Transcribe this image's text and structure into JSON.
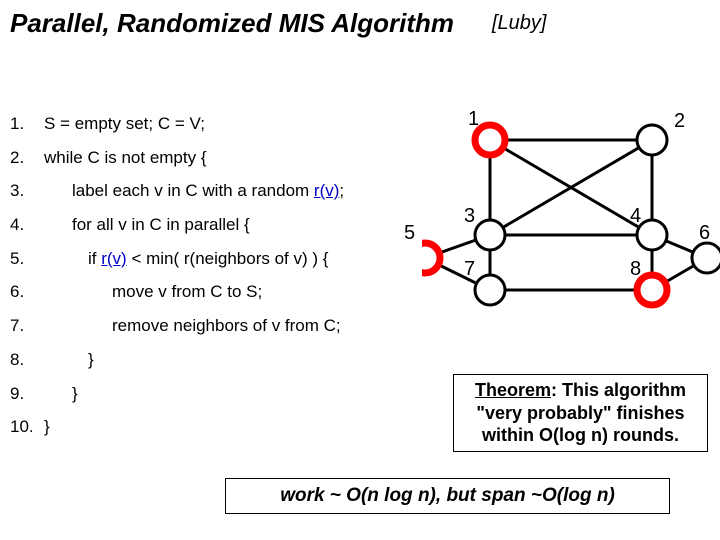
{
  "title": "Parallel, Randomized MIS Algorithm",
  "attribution": "[Luby]",
  "algo": {
    "l1_num": "1.",
    "l1_txt": "S = empty set;  C = V;",
    "l2_num": "2.",
    "l2_txt": "while  C  is not empty {",
    "l3_num": "3.",
    "l3_pre": "label each v in C with a random ",
    "l3_link": "r(v)",
    "l3_post": ";",
    "l4_num": "4.",
    "l4_txt": "for all v in C in parallel {",
    "l5_num": "5.",
    "l5_pre": "if ",
    "l5_link": "r(v)",
    "l5_post": " < min( r(neighbors of v) ) {",
    "l6_num": "6.",
    "l6_txt": "move v from C to S;",
    "l7_num": "7.",
    "l7_txt": "remove neighbors of v from C;",
    "l8_num": "8.",
    "l8_txt": "}",
    "l9_num": "9.",
    "l9_txt": "}",
    "l10_num": "10.",
    "l10_txt": "}"
  },
  "graph": {
    "nodes": {
      "n1": "1",
      "n2": "2",
      "n3": "3",
      "n4": "4",
      "n5": "5",
      "n6": "6",
      "n7": "7",
      "n8": "8"
    }
  },
  "theorem": {
    "under": "Theorem",
    "rest1": ":  This algorithm",
    "line2": "\"very probably\" finishes",
    "line3": "within O(log n) rounds."
  },
  "footer": "work ~ O(n log n),  but  span ~O(log n)"
}
